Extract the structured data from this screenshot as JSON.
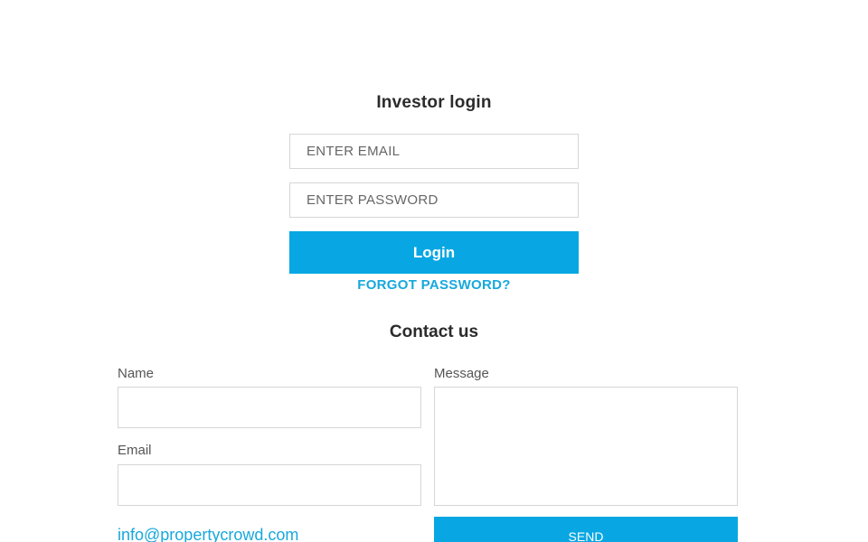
{
  "login": {
    "title": "Investor login",
    "email_placeholder": "ENTER EMAIL",
    "password_placeholder": "ENTER PASSWORD",
    "login_label": "Login",
    "forgot_label": "FORGOT PASSWORD?"
  },
  "contact": {
    "title": "Contact us",
    "name_label": "Name",
    "email_label": "Email",
    "message_label": "Message",
    "send_label": "SEND",
    "email_address": "info@propertycrowd.com"
  },
  "colors": {
    "accent": "#08a7e3",
    "link": "#17a8dc",
    "text": "#2b2b2b",
    "border": "#d6d6d6"
  }
}
